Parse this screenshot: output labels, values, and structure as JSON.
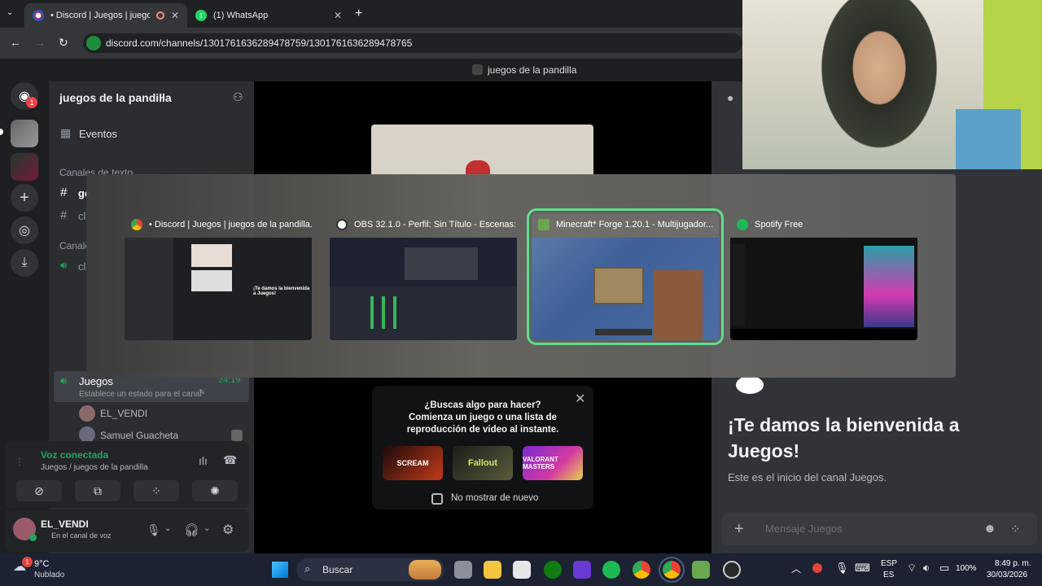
{
  "browser": {
    "tabs": [
      {
        "title": "• Discord | Juegos | juegos d",
        "active": true
      },
      {
        "title": "(1) WhatsApp",
        "active": false
      }
    ],
    "new_tab": "+",
    "url": "discord.com/channels/1301761636289478759/1301761636289478765"
  },
  "discord": {
    "window_title": "juegos de la pandilla",
    "server_name": "juegos de la pandilla",
    "guild_badge": "1",
    "events_label": "Eventos",
    "text_channels_header": "Canales de texto",
    "text_channels": [
      "ge",
      "cl"
    ],
    "voice_channels_header": "Canale",
    "voice_channels": [
      {
        "label": "cl"
      }
    ],
    "juegos_channel": {
      "label": "Juegos",
      "time": "24:19",
      "status_hint": "Establece un estado para el canal"
    },
    "voice_members": [
      "EL_VENDI",
      "Samuel Guacheta"
    ],
    "voice_connected": {
      "title": "Voz conectada",
      "subtitle": "Juegos / juegos de la pandilla"
    },
    "user": {
      "name": "EL_VENDI",
      "status": "En el canal de voz"
    },
    "chat": {
      "welcome_title": "¡Te damos la bienvenida a Juegos!",
      "welcome_sub": "Este es el inicio del canal Juegos.",
      "input_placeholder": "Mensaje Juegos"
    },
    "popup": {
      "line1": "¿Buscas algo para hacer?",
      "line2": "Comienza un juego o una lista de",
      "line3": "reproducción de video al instante.",
      "games": [
        "SCREAM",
        "Fallout",
        "VALORANT MASTERS"
      ],
      "checkbox_label": "No mostrar de nuevo"
    }
  },
  "alt_tab": {
    "windows": [
      {
        "title": "• Discord | Juegos | juegos de la pandilla...",
        "icon": "chrome-icon",
        "selected": false
      },
      {
        "title": "OBS 32.1.0 - Perfil: Sin Título - Escenas: Si...",
        "icon": "obs-icon",
        "selected": false
      },
      {
        "title": "Minecraft* Forge 1.20.1 - Multijugador...",
        "icon": "minecraft-icon",
        "selected": true
      },
      {
        "title": "Spotify Free",
        "icon": "spotify-icon",
        "selected": false
      }
    ],
    "thumb_text": "¡Te damos la bienvenida a Juegos!"
  },
  "taskbar": {
    "weather_temp": "9°C",
    "weather_desc": "Nublado",
    "weather_badge": "1",
    "search_label": "Buscar",
    "lang_top": "ESP",
    "lang_bottom": "ES",
    "battery": "100%",
    "time": "8:49 p. m.",
    "date": "30/03/2026"
  },
  "colors": {
    "accent_green": "#23a55a",
    "discord_bg": "#313338",
    "sidebar_bg": "#2b2d31",
    "selection": "#5dde8c"
  }
}
